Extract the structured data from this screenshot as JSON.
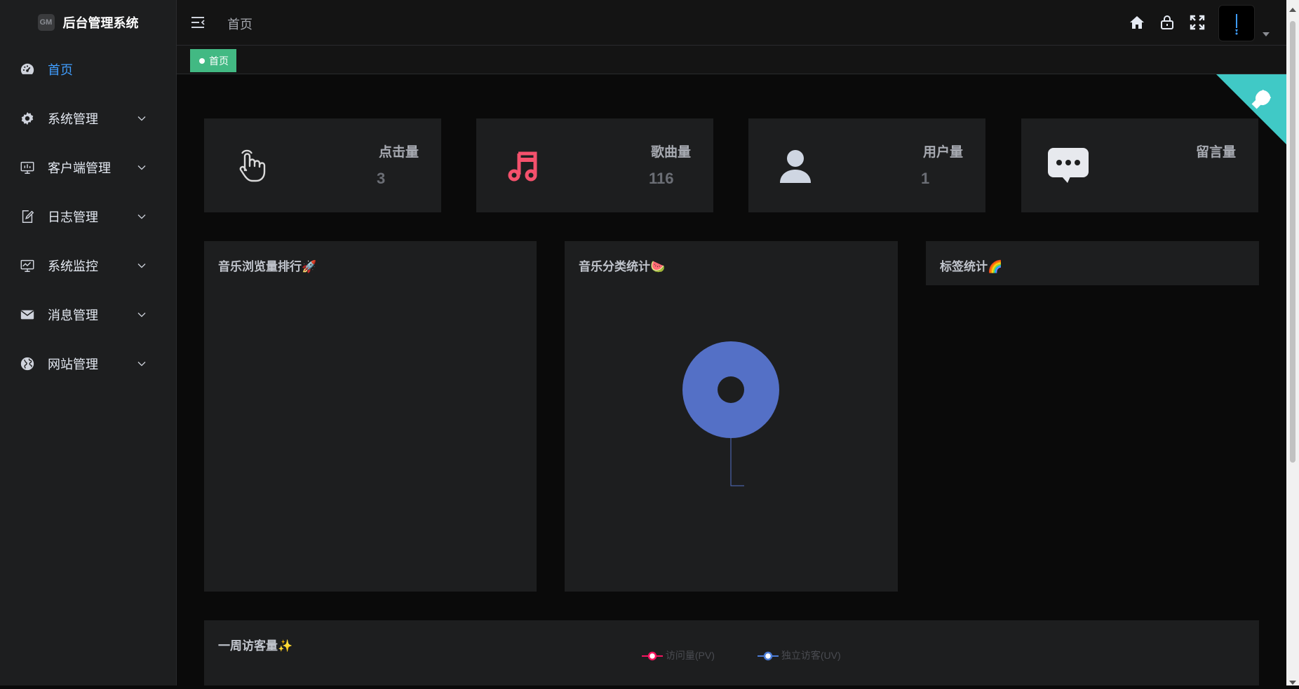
{
  "brand": {
    "logo_text": "GM",
    "title": "后台管理系统"
  },
  "sidebar": {
    "items": [
      {
        "label": "首页",
        "icon": "dashboard-icon",
        "active": true
      },
      {
        "label": "系统管理",
        "icon": "gear-icon"
      },
      {
        "label": "客户端管理",
        "icon": "monitor-icon"
      },
      {
        "label": "日志管理",
        "icon": "edit-document-icon"
      },
      {
        "label": "系统监控",
        "icon": "monitor-chart-icon"
      },
      {
        "label": "消息管理",
        "icon": "envelope-icon"
      },
      {
        "label": "网站管理",
        "icon": "globe-icon"
      }
    ]
  },
  "header": {
    "breadcrumb": "首页",
    "icons": [
      "home-icon",
      "lock-icon",
      "fullscreen-icon"
    ]
  },
  "tags": [
    {
      "label": "首页",
      "active": true
    }
  ],
  "stats": [
    {
      "title": "点击量",
      "value": "3",
      "icon": "hand-pointer-icon",
      "color": "#d9d9d9"
    },
    {
      "title": "歌曲量",
      "value": "116",
      "icon": "music-note-icon",
      "color": "#f4516c"
    },
    {
      "title": "用户量",
      "value": "1",
      "icon": "user-icon",
      "color": "#cfd6e2"
    },
    {
      "title": "留言量",
      "value": "",
      "icon": "message-bubble-icon",
      "color": "#e7e9ee"
    }
  ],
  "panels": {
    "music_rank": {
      "title": "音乐浏览量排行🚀"
    },
    "music_category": {
      "title": "音乐分类统计🍉"
    },
    "tag_stats": {
      "title": "标签统计🌈"
    },
    "weekly_visits": {
      "title": "一周访客量✨",
      "legend": [
        {
          "label": "访问量(PV)",
          "color": "#f5145f"
        },
        {
          "label": "独立访客(UV)",
          "color": "#4a7bd6"
        }
      ]
    }
  },
  "chart_data": {
    "type": "pie",
    "title": "音乐分类统计🍉",
    "slices": [
      {
        "name": "",
        "value": 1,
        "color": "#5470c6"
      }
    ]
  },
  "colors": {
    "accent": "#409eff",
    "tag_green": "#42b983",
    "corner_teal": "#40c9c6"
  }
}
